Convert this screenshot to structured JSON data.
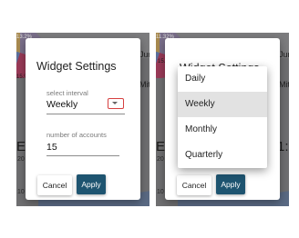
{
  "left_panel": {
    "background": {
      "pie_label_top": "13.2%",
      "pie_label_mid": "15.%",
      "row_label_1": "Jun",
      "row_label_2": "Mitc",
      "big_letter": "E",
      "small_number": "20",
      "axis_number": "10"
    },
    "dialog": {
      "title": "Widget Settings",
      "interval_label": "select interval",
      "interval_value": "Weekly",
      "accounts_label": "number of accounts",
      "accounts_value": "15",
      "cancel_label": "Cancel",
      "apply_label": "Apply"
    }
  },
  "right_panel": {
    "background": {
      "pie_label_top": "11.32%",
      "pie_label_mid": "15.",
      "row_label_1": "Jun",
      "row_label_2": "Mitc",
      "big_letter": "E",
      "right_number": "1:",
      "small_number": "20",
      "axis_number": "10"
    },
    "dialog": {
      "title_partial": "Widget Settings",
      "cancel_label": "Cancel",
      "apply_label": "Apply"
    },
    "menu": {
      "items": [
        {
          "label": "Daily",
          "selected": false
        },
        {
          "label": "Weekly",
          "selected": true
        },
        {
          "label": "Monthly",
          "selected": false
        },
        {
          "label": "Quarterly",
          "selected": false
        }
      ]
    }
  },
  "colors": {
    "apply_button": "#1e5470",
    "dropdown_highlight_border": "#d64040",
    "selected_item_background": "#e2e2e2",
    "overlay": "#6f6f71"
  }
}
